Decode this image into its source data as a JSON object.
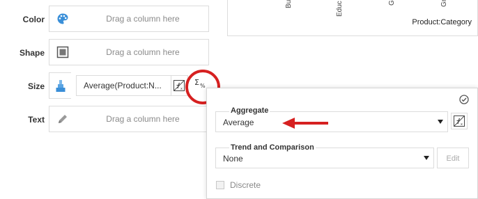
{
  "properties": {
    "color": {
      "label": "Color",
      "hint": "Drag a column here",
      "icon": "palette-icon"
    },
    "shape": {
      "label": "Shape",
      "hint": "Drag a column here",
      "icon": "shape-square-icon"
    },
    "size": {
      "label": "Size",
      "value": "Average(Product:N...",
      "icon": "size-icon",
      "fx_icon": "formula-icon",
      "aggregate_icon": "sigma-percent-icon"
    },
    "text": {
      "label": "Text",
      "hint": "Drag a column here",
      "icon": "pencil-icon"
    }
  },
  "chart": {
    "ticks": [
      "Bu",
      "Educ",
      "G",
      "Gr"
    ],
    "axis_title": "Product:Category"
  },
  "popup": {
    "aggregate": {
      "label": "Aggregate",
      "value": "Average"
    },
    "trend": {
      "label": "Trend and Comparison",
      "value": "None",
      "edit_label": "Edit"
    },
    "discrete": {
      "label": "Discrete",
      "checked": false
    }
  },
  "colors": {
    "accent_red": "#d62020",
    "icon_blue": "#3a8fd8",
    "border": "#dcdcdc"
  }
}
